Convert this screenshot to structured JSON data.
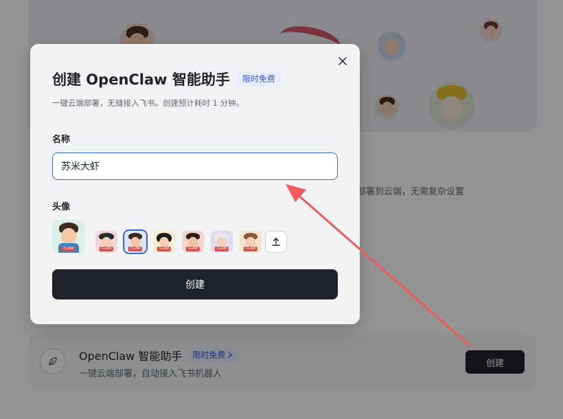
{
  "background": {
    "description_fragment": "部署到云端，无需复杂设置",
    "section_card": {
      "title": "OpenClaw 智能助手",
      "tag": "限时免费",
      "subtitle": "一键云端部署，自动接入飞书机器人",
      "button_label": "创建"
    }
  },
  "modal": {
    "title": "创建 OpenClaw 智能助手",
    "tag": "限时免费",
    "subtitle": "一键云端部署，无缝接入飞书。创建预计耗时 1 分钟。",
    "name_label": "名称",
    "name_value": "苏米大虾",
    "avatar_label": "头像",
    "avatar_badge": "CLAW",
    "selected_avatar_index": 1,
    "create_button": "创建"
  },
  "colors": {
    "accent": "#3f63d8",
    "dark_button": "#1f2329",
    "annotation_arrow": "#f05a5a"
  },
  "icons": {
    "close": "close-icon",
    "upload": "upload-icon",
    "card": "leaf-icon",
    "chevron": "chevron-right-icon"
  }
}
